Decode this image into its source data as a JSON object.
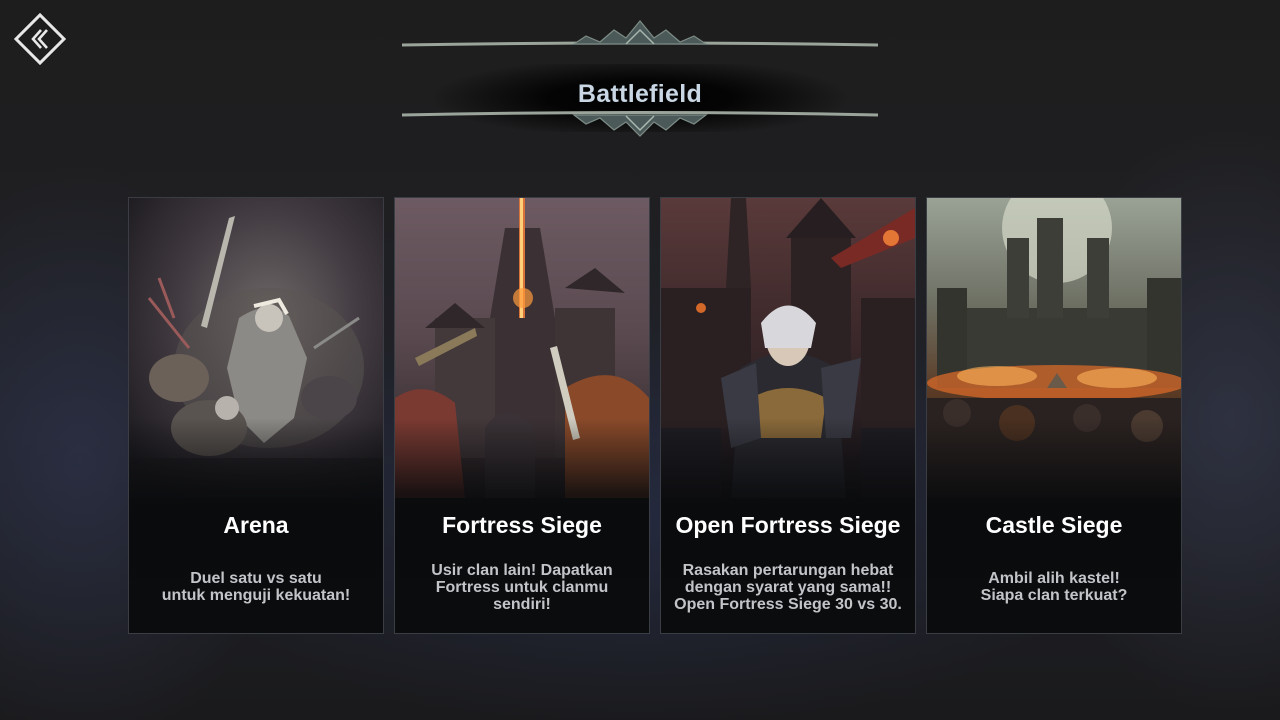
{
  "header": {
    "title": "Battlefield",
    "back_icon": "back-chevron-icon"
  },
  "colors": {
    "title_text": "#c9d6e3",
    "card_border": "#3b3d44",
    "ornament": "#9aa49a"
  },
  "cards": [
    {
      "title": "Arena",
      "description_lines": [
        "Duel satu vs satu",
        "untuk menguji kekuatan!"
      ]
    },
    {
      "title": "Fortress Siege",
      "description_lines": [
        "Usir clan lain! Dapatkan",
        "Fortress untuk clanmu",
        "sendiri!"
      ]
    },
    {
      "title": "Open Fortress Siege",
      "description_lines": [
        "Rasakan pertarungan hebat",
        "dengan syarat yang sama!!",
        "Open Fortress Siege 30 vs 30."
      ]
    },
    {
      "title": "Castle Siege",
      "description_lines": [
        "Ambil alih kastel!",
        "Siapa clan terkuat?"
      ]
    }
  ]
}
